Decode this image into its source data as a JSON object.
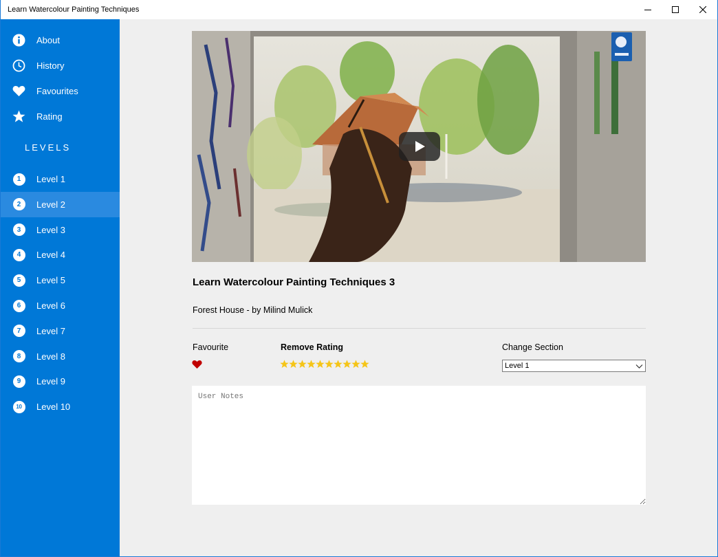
{
  "window": {
    "title": "Learn Watercolour Painting Techniques"
  },
  "sidebar": {
    "menu": [
      {
        "label": "About",
        "icon": "info-icon"
      },
      {
        "label": "History",
        "icon": "clock-icon"
      },
      {
        "label": "Favourites",
        "icon": "heart-icon"
      },
      {
        "label": "Rating",
        "icon": "star-icon"
      }
    ],
    "levels_heading": "LEVELS",
    "levels": [
      {
        "num": "1",
        "label": "Level 1"
      },
      {
        "num": "2",
        "label": "Level 2",
        "active": true
      },
      {
        "num": "3",
        "label": "Level 3"
      },
      {
        "num": "4",
        "label": "Level 4"
      },
      {
        "num": "5",
        "label": "Level 5"
      },
      {
        "num": "6",
        "label": "Level 6"
      },
      {
        "num": "7",
        "label": "Level 7"
      },
      {
        "num": "8",
        "label": "Level 8"
      },
      {
        "num": "9",
        "label": "Level 9"
      },
      {
        "num": "10",
        "label": "Level 10"
      }
    ]
  },
  "video": {
    "title": "Learn Watercolour Painting Techniques 3",
    "subtitle": "Forest House - by Milind Mulick"
  },
  "controls": {
    "favourite_label": "Favourite",
    "rating_label": "Remove Rating",
    "rating_value": 10,
    "rating_max": 10,
    "section_label": "Change Section",
    "section_selected": "Level 1"
  },
  "notes": {
    "placeholder": "User Notes"
  },
  "colors": {
    "accent": "#0078d7",
    "active_item": "#2a8ae0",
    "star": "#f5c518",
    "heart": "#c00000"
  }
}
